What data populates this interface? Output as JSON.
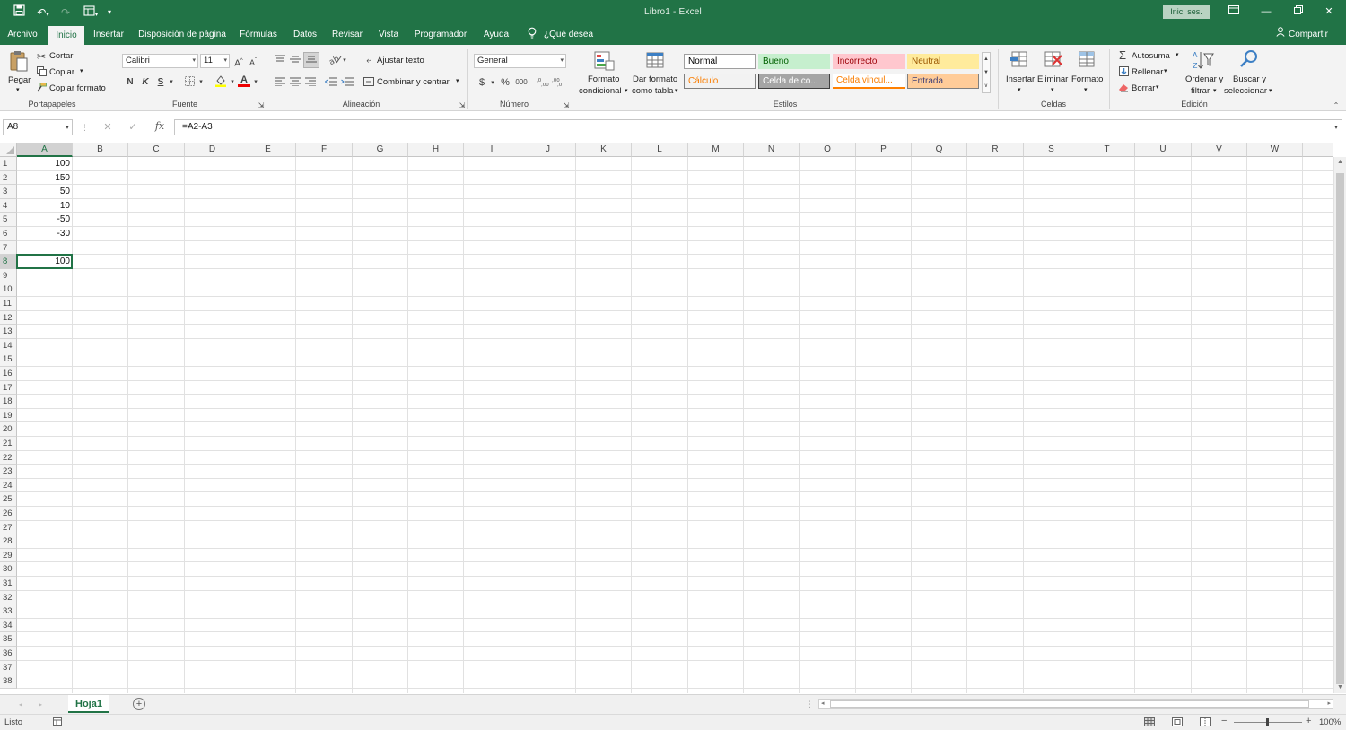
{
  "title": {
    "doc": "Libro1",
    "sep": "-",
    "app": "Excel",
    "sign_in": "Inic. ses."
  },
  "tabs": [
    "Archivo",
    "Inicio",
    "Insertar",
    "Disposición de página",
    "Fórmulas",
    "Datos",
    "Revisar",
    "Vista",
    "Programador",
    "Ayuda"
  ],
  "tell_me": "¿Qué desea hacer?",
  "share": "Compartir",
  "ribbon": {
    "clipboard": {
      "paste": "Pegar",
      "cut": "Cortar",
      "copy": "Copiar",
      "format_painter": "Copiar formato",
      "label": "Portapapeles"
    },
    "font": {
      "name": "Calibri",
      "size": "11",
      "bold": "N",
      "italic": "K",
      "underline": "S",
      "label": "Fuente"
    },
    "alignment": {
      "wrap": "Ajustar texto",
      "merge": "Combinar y centrar",
      "label": "Alineación"
    },
    "number": {
      "format": "General",
      "currency": "$",
      "percent": "%",
      "thousands": "000",
      "label": "Número"
    },
    "styles": {
      "cond_format_1": "Formato",
      "cond_format_2": "condicional",
      "table_format_1": "Dar formato",
      "table_format_2": "como tabla",
      "cells": [
        {
          "text": "Normal",
          "bg": "#ffffff",
          "fg": "#000000",
          "border": "#9e9e9e"
        },
        {
          "text": "Bueno",
          "bg": "#c6efce",
          "fg": "#006100",
          "border": "#c6efce"
        },
        {
          "text": "Incorrecto",
          "bg": "#ffc7ce",
          "fg": "#9c0006",
          "border": "#ffc7ce"
        },
        {
          "text": "Neutral",
          "bg": "#ffeb9c",
          "fg": "#9c5700",
          "border": "#ffeb9c"
        },
        {
          "text": "Cálculo",
          "bg": "#f2f2f2",
          "fg": "#fa7d00",
          "border": "#7f7f7f"
        },
        {
          "text": "Celda de co...",
          "bg": "#a5a5a5",
          "fg": "#ffffff",
          "border": "#3f3f3f"
        },
        {
          "text": "Celda vincul...",
          "bg": "#ffffff",
          "fg": "#fa7d00",
          "border": "#ff8001"
        },
        {
          "text": "Entrada",
          "bg": "#ffcc99",
          "fg": "#3f3f76",
          "border": "#7f7f7f"
        }
      ],
      "label": "Estilos"
    },
    "cells": {
      "insert": "Insertar",
      "delete": "Eliminar",
      "format": "Formato",
      "label": "Celdas"
    },
    "editing": {
      "autosum": "Autosuma",
      "fill": "Rellenar",
      "clear": "Borrar",
      "sort_1": "Ordenar y",
      "sort_2": "filtrar",
      "find_1": "Buscar y",
      "find_2": "seleccionar",
      "label": "Edición"
    }
  },
  "formula_bar": {
    "name_box": "A8",
    "fx": "fx",
    "formula": "=A2-A3"
  },
  "columns": [
    "A",
    "B",
    "C",
    "D",
    "E",
    "F",
    "G",
    "H",
    "I",
    "J",
    "K",
    "L",
    "M",
    "N",
    "O",
    "P",
    "Q",
    "R",
    "S",
    "T",
    "U",
    "V",
    "W"
  ],
  "rows": [
    "1",
    "2",
    "3",
    "4",
    "5",
    "6",
    "7",
    "8",
    "9",
    "10",
    "11",
    "12",
    "13",
    "14",
    "15",
    "16",
    "17",
    "18",
    "19",
    "20",
    "21",
    "22",
    "23",
    "24",
    "25",
    "26",
    "27",
    "28",
    "29",
    "30",
    "31",
    "32",
    "33",
    "34",
    "35",
    "36",
    "37",
    "38"
  ],
  "cells": [
    {
      "ref": "A1",
      "row": 1,
      "value": "100"
    },
    {
      "ref": "A2",
      "row": 2,
      "value": "150"
    },
    {
      "ref": "A3",
      "row": 3,
      "value": "50"
    },
    {
      "ref": "A4",
      "row": 4,
      "value": "10"
    },
    {
      "ref": "A5",
      "row": 5,
      "value": "-50"
    },
    {
      "ref": "A6",
      "row": 6,
      "value": "-30"
    },
    {
      "ref": "A8",
      "row": 8,
      "value": "100"
    }
  ],
  "sheet": {
    "name": "Hoja1"
  },
  "status": {
    "mode": "Listo",
    "zoom": "100%"
  },
  "colors": {
    "brand": "#217346"
  }
}
